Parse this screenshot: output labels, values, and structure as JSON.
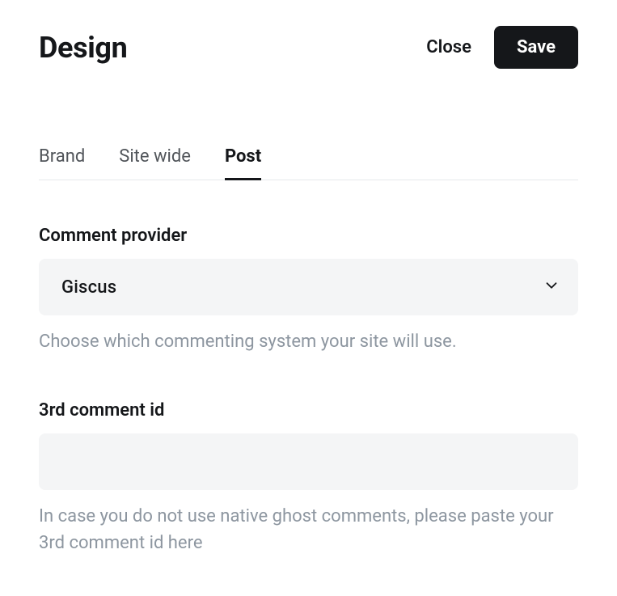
{
  "header": {
    "title": "Design",
    "close_label": "Close",
    "save_label": "Save"
  },
  "tabs": {
    "brand": "Brand",
    "site_wide": "Site wide",
    "post": "Post"
  },
  "fields": {
    "comment_provider": {
      "label": "Comment provider",
      "value": "Giscus",
      "help": "Choose which commenting system your site will use."
    },
    "third_comment_id": {
      "label": "3rd comment id",
      "value": "",
      "help": "In case you do not use native ghost comments, please paste your 3rd comment id here"
    }
  }
}
